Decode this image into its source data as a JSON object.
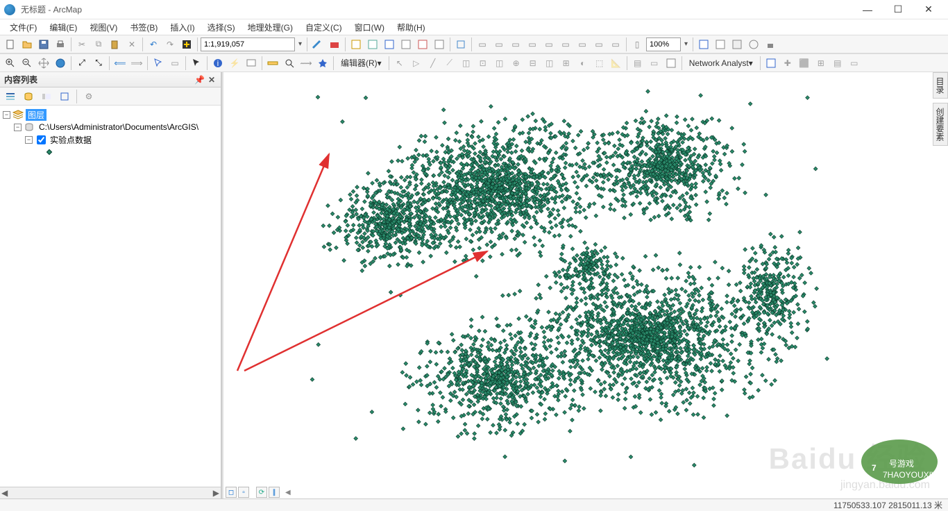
{
  "window": {
    "title": "无标题 - ArcMap"
  },
  "menu": {
    "file": "文件(F)",
    "edit": "编辑(E)",
    "view": "视图(V)",
    "bookmark": "书签(B)",
    "insert": "插入(I)",
    "select": "选择(S)",
    "geoprocess": "地理处理(G)",
    "customize": "自定义(C)",
    "window": "窗口(W)",
    "help": "帮助(H)"
  },
  "toolbar": {
    "scale": "1:1,919,057",
    "zoom": "100%",
    "editor": "编辑器(R)",
    "network": "Network Analyst"
  },
  "toc": {
    "title": "内容列表",
    "root": "图层",
    "datasource": "C:\\Users\\Administrator\\Documents\\ArcGIS\\",
    "layer": "实验点数据"
  },
  "right": {
    "catalog": "目录",
    "create": "创建要素"
  },
  "status": {
    "coords": "11750533.107  2815011.13 米"
  }
}
